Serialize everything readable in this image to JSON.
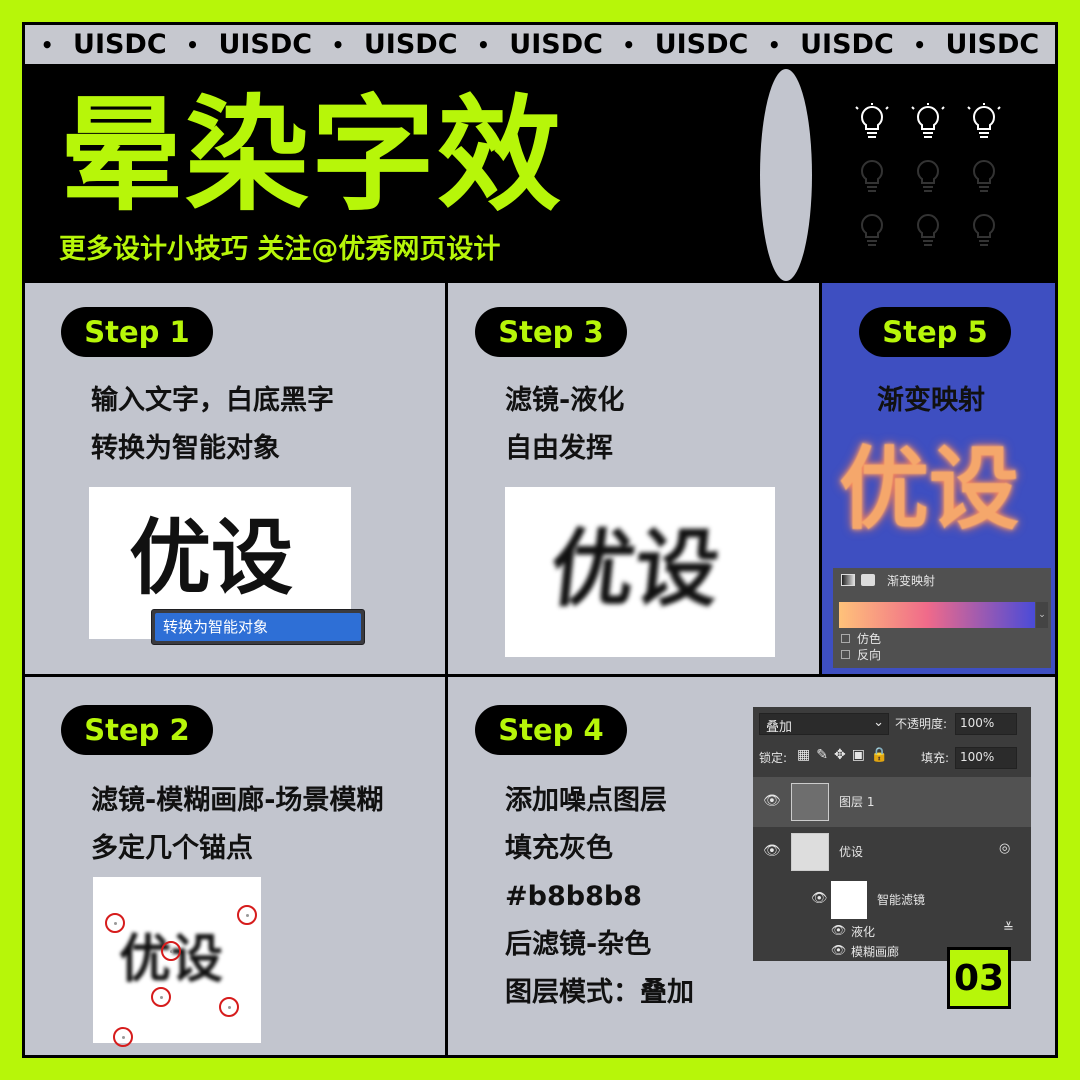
{
  "ticker": [
    "UISDC",
    "UISDC",
    "UISDC",
    "UISDC",
    "UISDC",
    "UISDC",
    "UISDC"
  ],
  "header": {
    "title": "晕染字效",
    "subtitle": "更多设计小技巧 关注@优秀网页设计"
  },
  "colors": {
    "accent": "#b7f609",
    "panel": "#c2c5ce",
    "step5_bg": "#3e4fc1"
  },
  "steps": [
    {
      "label": "Step 1",
      "lines": [
        "输入文字，白底黑字",
        "转换为智能对象"
      ],
      "sample": "优设",
      "menu_item": "转换为智能对象"
    },
    {
      "label": "Step 2",
      "lines": [
        "滤镜-模糊画廊-场景模糊",
        "多定几个锚点"
      ],
      "sample": "优设"
    },
    {
      "label": "Step 3",
      "lines": [
        "滤镜-液化",
        "自由发挥"
      ],
      "sample": "优设"
    },
    {
      "label": "Step 4",
      "lines": [
        "添加噪点图层",
        "填充灰色",
        "#b8b8b8",
        "后滤镜-杂色",
        "图层模式：叠加"
      ]
    },
    {
      "label": "Step 5",
      "lines": [
        "渐变映射"
      ],
      "sample": "优设",
      "panel": {
        "title": "渐变映射",
        "opt1": "仿色",
        "opt2": "反向"
      }
    }
  ],
  "layers_panel": {
    "blend_mode": "叠加",
    "opacity_label": "不透明度:",
    "opacity": "100%",
    "lock_label": "锁定:",
    "fill_label": "填充:",
    "fill": "100%",
    "layer1": "图层 1",
    "layer2": "优设",
    "smart_filter": "智能滤镜",
    "filter1": "液化",
    "filter2": "模糊画廊"
  },
  "page_number": "03"
}
